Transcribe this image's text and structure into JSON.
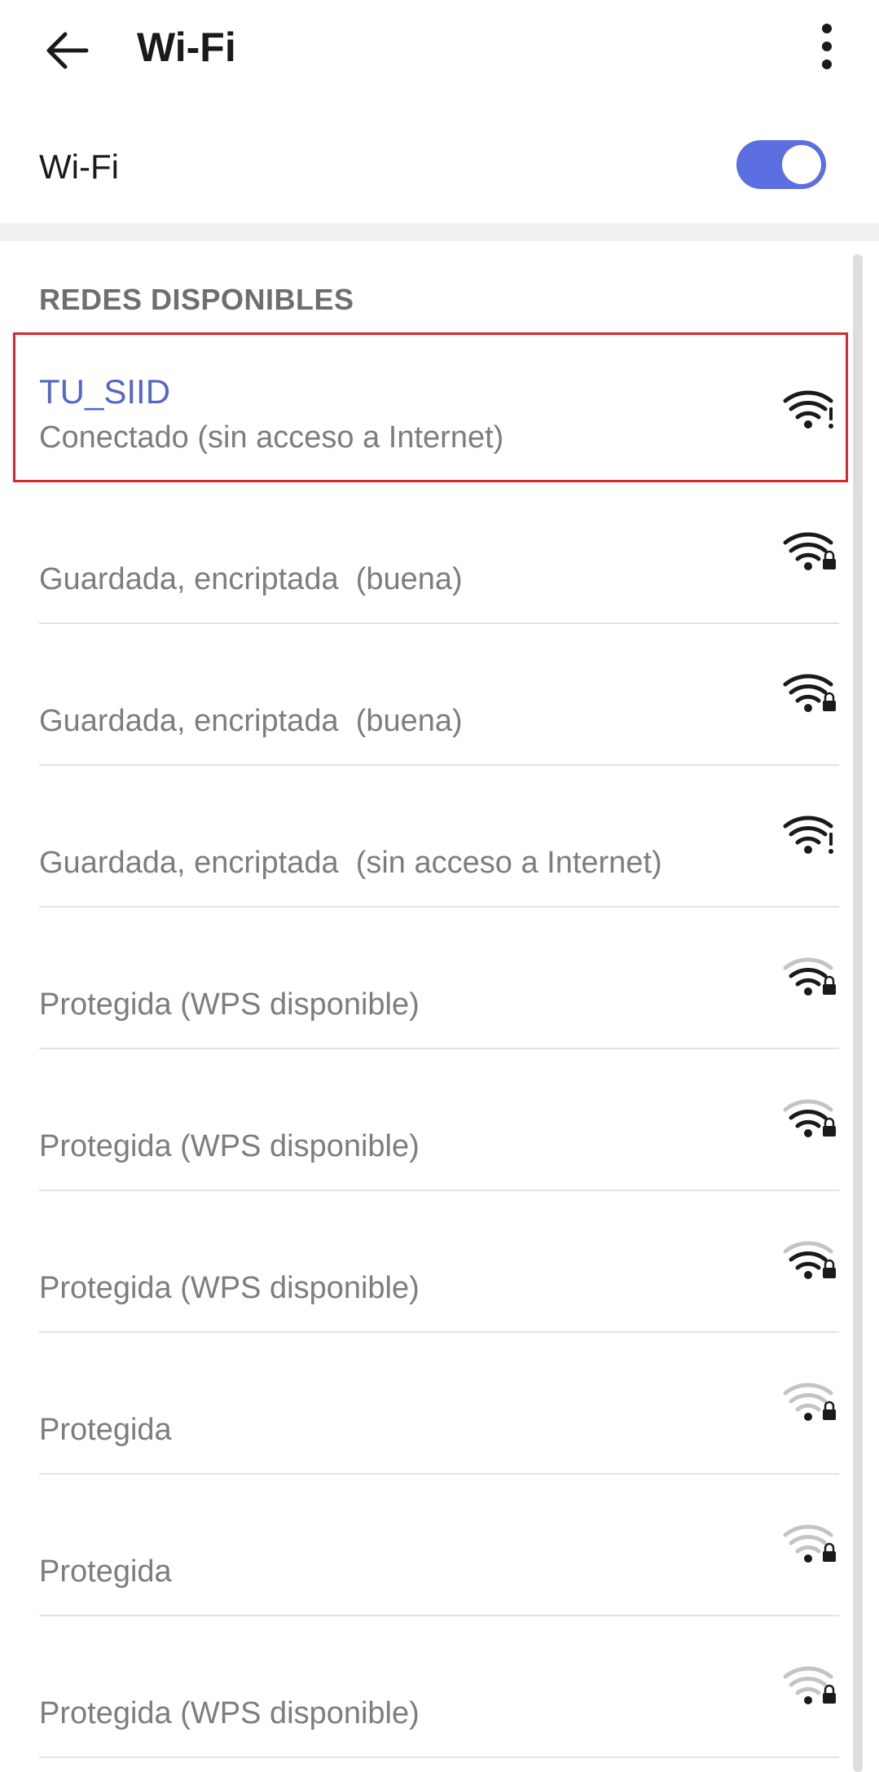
{
  "appbar": {
    "title": "Wi-Fi",
    "back_icon": "arrow-back-icon",
    "menu_icon": "more-vert-icon"
  },
  "wifi_toggle": {
    "label": "Wi-Fi",
    "enabled": true
  },
  "section": {
    "header": "REDES DISPONIBLES"
  },
  "colors": {
    "accent": "#5c6fe0",
    "connected_name": "#5468c4",
    "highlight": "#d9262b"
  },
  "networks": [
    {
      "name": "TU_SIID",
      "status": "Conectado (sin acceso a Internet)",
      "icon": "wifi-no-internet-icon",
      "signal": 4,
      "badge": "alert"
    },
    {
      "name": "",
      "status": "Guardada, encriptada  (buena)",
      "icon": "wifi-lock-icon",
      "signal": 4,
      "badge": "lock"
    },
    {
      "name": "",
      "status": "Guardada, encriptada  (buena)",
      "icon": "wifi-lock-icon",
      "signal": 4,
      "badge": "lock"
    },
    {
      "name": "",
      "status": "Guardada, encriptada  (sin acceso a Internet)",
      "icon": "wifi-no-internet-icon",
      "signal": 4,
      "badge": "alert"
    },
    {
      "name": "",
      "status": "Protegida (WPS disponible)",
      "icon": "wifi-lock-icon",
      "signal": 3,
      "badge": "lock"
    },
    {
      "name": "",
      "status": "Protegida (WPS disponible)",
      "icon": "wifi-lock-icon",
      "signal": 3,
      "badge": "lock"
    },
    {
      "name": "",
      "status": "Protegida (WPS disponible)",
      "icon": "wifi-lock-icon",
      "signal": 3,
      "badge": "lock"
    },
    {
      "name": "",
      "status": "Protegida",
      "icon": "wifi-lock-icon",
      "signal": 1,
      "badge": "lock"
    },
    {
      "name": "",
      "status": "Protegida",
      "icon": "wifi-lock-icon",
      "signal": 1,
      "badge": "lock"
    },
    {
      "name": "",
      "status": "Protegida (WPS disponible)",
      "icon": "wifi-lock-icon",
      "signal": 1,
      "badge": "lock"
    }
  ]
}
